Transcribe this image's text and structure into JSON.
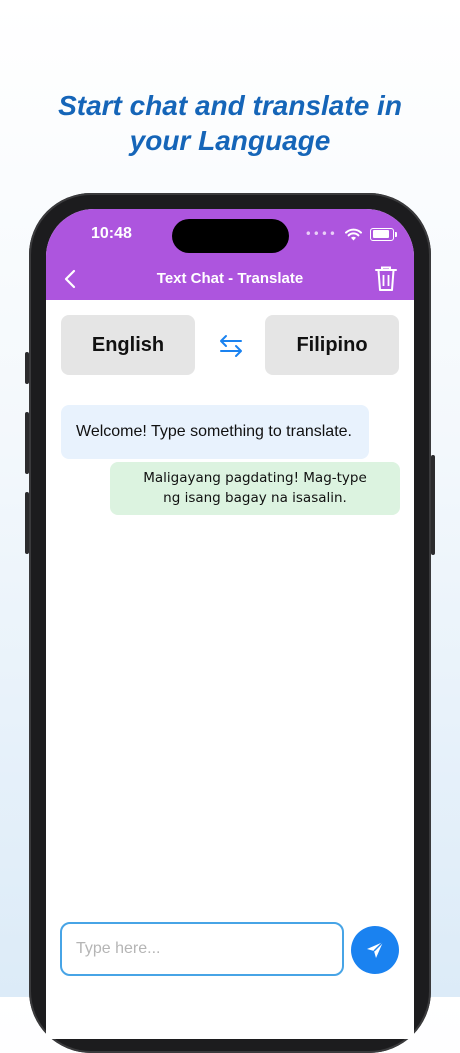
{
  "promo": {
    "headline_line1": "Start chat and translate in",
    "headline_line2": "your Language"
  },
  "status_bar": {
    "time": "10:48",
    "signal_dots": "••••",
    "wifi_icon": "wifi-icon",
    "battery_icon": "battery-icon"
  },
  "navbar": {
    "title": "Text Chat - Translate",
    "back_icon": "chevron-left-icon",
    "delete_icon": "trash-icon",
    "background_color": "#ad55de"
  },
  "languages": {
    "source": "English",
    "target": "Filipino",
    "swap_icon": "swap-arrows-icon"
  },
  "messages": [
    {
      "side": "left",
      "text": "Welcome! Type something to translate."
    },
    {
      "side": "right",
      "line1": "Maligayang pagdating! Mag-type",
      "line2": "ng isang bagay na isasalin."
    }
  ],
  "composer": {
    "placeholder": "Type here...",
    "value": "",
    "send_icon": "send-icon"
  },
  "colors": {
    "accent_blue": "#1565b8",
    "send_button": "#1a82f0",
    "left_bubble": "#e8f2fd",
    "right_bubble": "#dcf3e0"
  }
}
